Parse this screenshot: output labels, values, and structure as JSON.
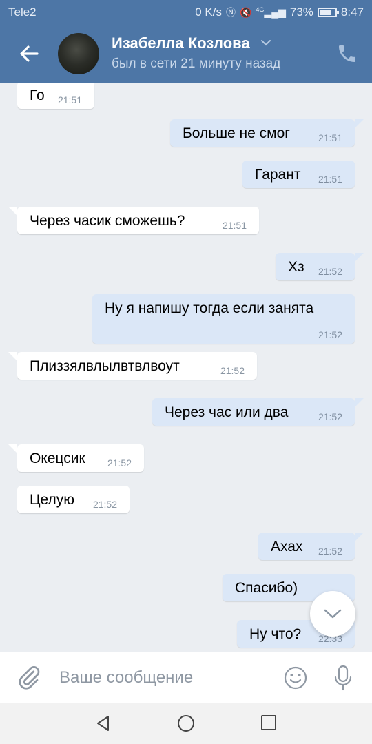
{
  "status_bar": {
    "carrier": "Tele2",
    "net_speed": "0 K/s",
    "network": "4G",
    "battery": "73%",
    "battery_level": 0.73,
    "time": "8:47"
  },
  "header": {
    "contact_name": "Изабелла Козлова",
    "contact_status": "был в сети 21 минуту назад"
  },
  "messages": [
    {
      "dir": "in",
      "text": "Го",
      "time": "21:51"
    },
    {
      "dir": "out",
      "text": "Больше не смог",
      "time": "21:51"
    },
    {
      "dir": "out",
      "text": "Гарант",
      "time": "21:51"
    },
    {
      "dir": "in",
      "text": "Через часик сможешь?",
      "time": "21:51"
    },
    {
      "dir": "out",
      "text": "Хз",
      "time": "21:52"
    },
    {
      "dir": "out",
      "text": "Ну я напишу тогда если занята",
      "time": "21:52"
    },
    {
      "dir": "in",
      "text": "Плиззялвлылвтвлвоут",
      "time": "21:52"
    },
    {
      "dir": "out",
      "text": "Через час или два",
      "time": "21:52"
    },
    {
      "dir": "in",
      "text": "Окецсик",
      "time": "21:52"
    },
    {
      "dir": "in",
      "text": "Целую",
      "time": "21:52"
    },
    {
      "dir": "out",
      "text": "Ахах",
      "time": "21:52"
    },
    {
      "dir": "out",
      "text": "Спасибо)",
      "time": ""
    },
    {
      "dir": "out",
      "text": "Ну что?",
      "time": "22:33"
    }
  ],
  "input": {
    "placeholder": "Ваше сообщение"
  },
  "icons": {
    "back": "back-arrow-icon",
    "call": "phone-icon",
    "attach": "paperclip-icon",
    "emoji": "smiley-icon",
    "mic": "microphone-icon",
    "scroll": "chevron-down-icon"
  },
  "colors": {
    "header_bg": "#4d76a6",
    "incoming_bubble": "#ffffff",
    "outgoing_bubble": "#dbe7f7",
    "chat_bg": "#ebeef2"
  }
}
